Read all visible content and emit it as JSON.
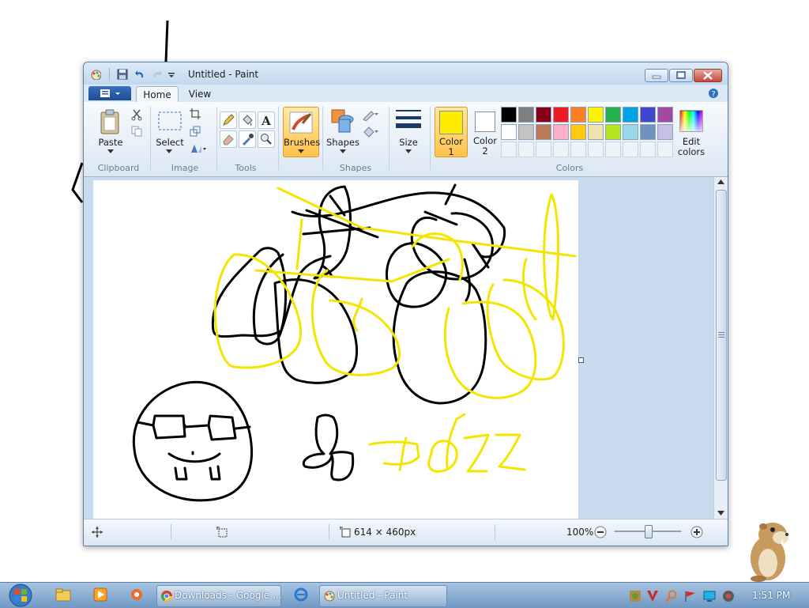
{
  "window": {
    "title": "Untitled - Paint",
    "minimize_icon": "minimize-icon",
    "maximize_icon": "maximize-icon",
    "close_icon": "close-icon"
  },
  "ribbon": {
    "tabs": [
      {
        "label": "Home",
        "active": true
      },
      {
        "label": "View",
        "active": false
      }
    ],
    "groups": {
      "clipboard": {
        "label": "Clipboard",
        "paste_label": "Paste"
      },
      "image": {
        "label": "Image",
        "select_label": "Select"
      },
      "tools": {
        "label": "Tools"
      },
      "brushes": {
        "label": "Brushes"
      },
      "shapes": {
        "label": "Shapes",
        "shapes_label": "Shapes"
      },
      "size": {
        "label": "Size"
      },
      "colors": {
        "label": "Colors",
        "color1_label": "Color\n1",
        "color1_line1": "Color",
        "color1_line2": "1",
        "color2_line1": "Color",
        "color2_line2": "2",
        "edit_line1": "Edit",
        "edit_line2": "colors",
        "color1": "#ffeb00",
        "color2": "#ffffff",
        "palette_row1": [
          "#000000",
          "#7f7f7f",
          "#880015",
          "#ed1c24",
          "#ff7f27",
          "#fff200",
          "#22b14c",
          "#00a2e8",
          "#3f48cc",
          "#a349a4"
        ],
        "palette_row2": [
          "#ffffff",
          "#c3c3c3",
          "#b97a57",
          "#ffaec9",
          "#ffc90e",
          "#efe4b0",
          "#b5e61d",
          "#99d9ea",
          "#7092be",
          "#c8bfe7"
        ]
      }
    }
  },
  "statusbar": {
    "image_size": "614 × 460px",
    "zoom": "100%"
  },
  "taskbar": {
    "buttons": [
      {
        "label": "Downloads - Google ..."
      },
      {
        "label": "Untitled - Paint"
      }
    ],
    "clock": "1:51 PM"
  }
}
